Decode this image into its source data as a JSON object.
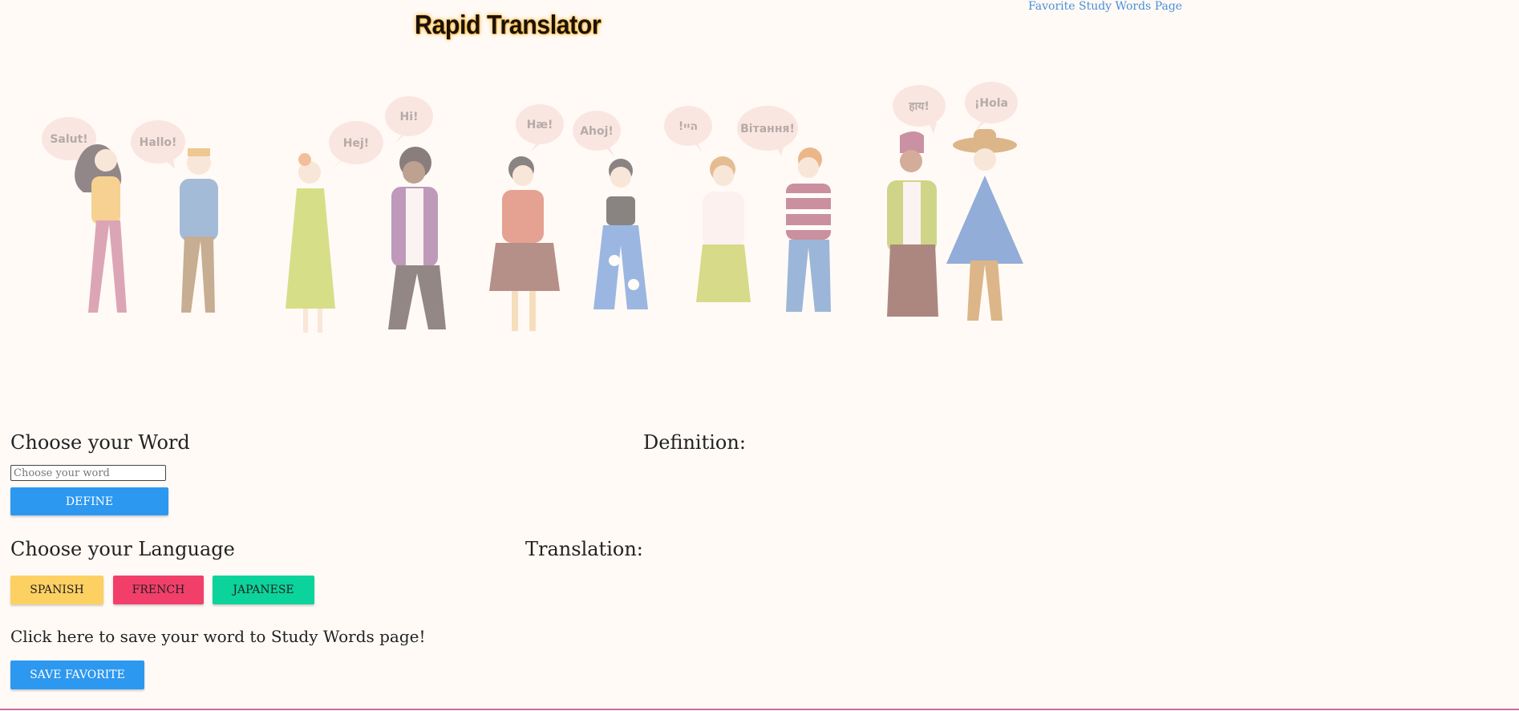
{
  "header": {
    "title": "Rapid Translator",
    "favorite_link": "Favorite Study Words Page"
  },
  "illustration": {
    "greetings": [
      "Salut!",
      "Hallo!",
      "Hej!",
      "Hi!",
      "Hæ!",
      "Ahoj!",
      "!היי",
      "Вітання!",
      "हाय!",
      "¡Hola"
    ]
  },
  "word_section": {
    "heading": "Choose your Word",
    "input_placeholder": "Choose your word",
    "input_value": "",
    "define_label": "DEFINE",
    "definition_label": "Definition:"
  },
  "language_section": {
    "heading": "Choose your Language",
    "translation_label": "Translation:",
    "buttons": [
      "SPANISH",
      "FRENCH",
      "JAPANESE"
    ]
  },
  "save_section": {
    "prompt": "Click here to save your word to Study Words page!",
    "save_label": "SAVE FAVORITE"
  },
  "colors": {
    "primary_blue": "#2d98f0",
    "spanish": "#fdd062",
    "french": "#f23f6a",
    "japanese": "#0bd39b",
    "background": "#fffaf6"
  }
}
